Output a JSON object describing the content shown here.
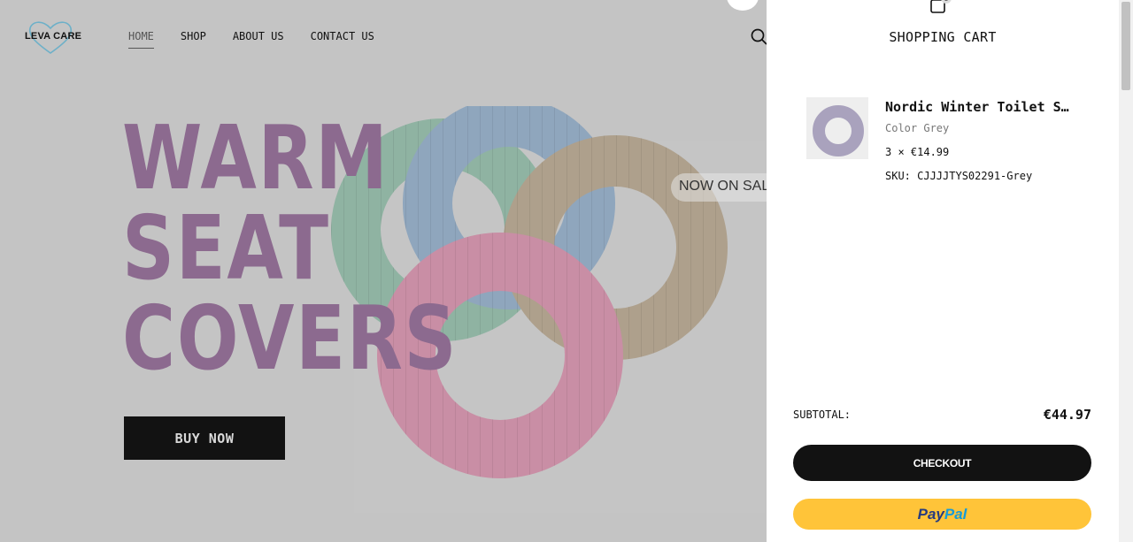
{
  "site": {
    "logo_text": "LEVA CARE",
    "nav": [
      {
        "label": "HOME",
        "active": true
      },
      {
        "label": "SHOP"
      },
      {
        "label": "ABOUT US"
      },
      {
        "label": "CONTACT US"
      }
    ]
  },
  "hero": {
    "headline": [
      "WARM",
      "SEAT",
      "COVERS"
    ],
    "sale_text": "NOW ON SALE",
    "cta": "BUY NOW"
  },
  "cart": {
    "title": "SHOPPING CART",
    "count": "3",
    "items": [
      {
        "name": "Nordic Winter Toilet S…",
        "variant": "Color Grey",
        "qty_price": "3 × €14.99",
        "sku": "SKU: CJJJJTYS02291-Grey"
      }
    ],
    "subtotal_label": "SUBTOTAL:",
    "subtotal_value": "€44.97",
    "checkout_label": "CHECKOUT",
    "paypal": {
      "pay": "Pay",
      "pal": "Pal"
    }
  },
  "colors": {
    "overlay_bg": "#c4c4c4",
    "headline": "#8c6a8f",
    "button_dark": "#121212",
    "paypal_yellow": "#ffc439"
  }
}
